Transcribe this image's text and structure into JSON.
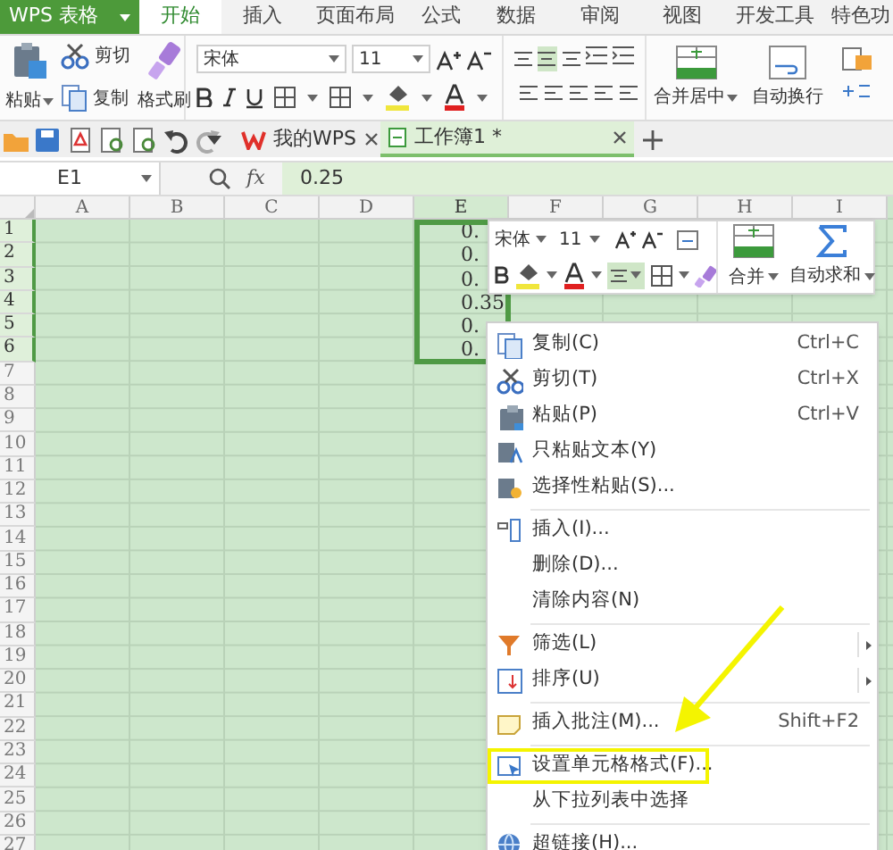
{
  "app_button": {
    "label": "WPS 表格"
  },
  "menu_tabs": [
    {
      "label": "开始",
      "selected": true
    },
    {
      "label": "插入",
      "selected": false
    },
    {
      "label": "页面布局",
      "selected": false
    },
    {
      "label": "公式",
      "selected": false
    },
    {
      "label": "数据",
      "selected": false
    },
    {
      "label": "审阅",
      "selected": false
    },
    {
      "label": "视图",
      "selected": false
    },
    {
      "label": "开发工具",
      "selected": false
    },
    {
      "label": "特色功",
      "selected": false
    }
  ],
  "ribbon": {
    "paste": "粘贴",
    "cut": "剪切",
    "copy": "复制",
    "format_painter": "格式刷",
    "font_name": "宋体",
    "font_size": "11",
    "merge_center": "合并居中",
    "wrap_text": "自动换行",
    "alignment": [
      {
        "selected": false
      },
      {
        "selected": true
      },
      {
        "selected": false
      }
    ]
  },
  "doc_tabs": [
    {
      "label": "我的WPS",
      "selected": false
    },
    {
      "label": "工作簿1 *",
      "selected": true
    }
  ],
  "formula_bar": {
    "cell_ref": "E1",
    "fx": "fx",
    "value": "0.25"
  },
  "sheet": {
    "columns": [
      {
        "label": "A",
        "selected": false
      },
      {
        "label": "B",
        "selected": false
      },
      {
        "label": "C",
        "selected": false
      },
      {
        "label": "D",
        "selected": false
      },
      {
        "label": "E",
        "selected": true
      },
      {
        "label": "F",
        "selected": false
      },
      {
        "label": "G",
        "selected": false
      },
      {
        "label": "H",
        "selected": false
      },
      {
        "label": "I",
        "selected": false
      }
    ],
    "rows": [
      {
        "label": "1",
        "selected": true,
        "e": "0."
      },
      {
        "label": "2",
        "selected": true,
        "e": "0."
      },
      {
        "label": "3",
        "selected": true,
        "e": "0."
      },
      {
        "label": "4",
        "selected": true,
        "e": "0.35"
      },
      {
        "label": "5",
        "selected": true,
        "e": "0."
      },
      {
        "label": "6",
        "selected": true,
        "e": "0."
      },
      {
        "label": "7",
        "selected": false
      },
      {
        "label": "8",
        "selected": false
      },
      {
        "label": "9",
        "selected": false
      },
      {
        "label": "10",
        "selected": false
      },
      {
        "label": "11",
        "selected": false
      },
      {
        "label": "12",
        "selected": false
      },
      {
        "label": "13",
        "selected": false
      },
      {
        "label": "14",
        "selected": false
      },
      {
        "label": "15",
        "selected": false
      },
      {
        "label": "16",
        "selected": false
      },
      {
        "label": "17",
        "selected": false
      },
      {
        "label": "18",
        "selected": false
      },
      {
        "label": "19",
        "selected": false
      },
      {
        "label": "20",
        "selected": false
      },
      {
        "label": "21",
        "selected": false
      },
      {
        "label": "22",
        "selected": false
      },
      {
        "label": "23",
        "selected": false
      },
      {
        "label": "24",
        "selected": false
      },
      {
        "label": "25",
        "selected": false
      },
      {
        "label": "26",
        "selected": false
      },
      {
        "label": "27",
        "selected": false
      }
    ]
  },
  "mini_toolbar": {
    "font_name": "宋体",
    "font_size": "11",
    "merge": "合并",
    "autosum": "自动求和",
    "center_align": {
      "selected": true
    }
  },
  "context_menu": {
    "items": [
      {
        "kind": "item",
        "label": "复制(C)",
        "shortcut": "Ctrl+C"
      },
      {
        "kind": "item",
        "label": "剪切(T)",
        "shortcut": "Ctrl+X"
      },
      {
        "kind": "item",
        "label": "粘贴(P)",
        "shortcut": "Ctrl+V"
      },
      {
        "kind": "item",
        "label": "只粘贴文本(Y)"
      },
      {
        "kind": "item",
        "label": "选择性粘贴(S)..."
      },
      {
        "kind": "separator"
      },
      {
        "kind": "item",
        "label": "插入(I)..."
      },
      {
        "kind": "item",
        "label": "删除(D)..."
      },
      {
        "kind": "item",
        "label": "清除内容(N)"
      },
      {
        "kind": "separator"
      },
      {
        "kind": "item",
        "label": "筛选(L)",
        "submenu": true
      },
      {
        "kind": "item",
        "label": "排序(U)",
        "submenu": true
      },
      {
        "kind": "separator"
      },
      {
        "kind": "item",
        "label": "插入批注(M)...",
        "shortcut": "Shift+F2"
      },
      {
        "kind": "separator"
      },
      {
        "kind": "item",
        "label": "设置单元格格式(F)...",
        "marked": true
      },
      {
        "kind": "item",
        "label": "从下拉列表中选择"
      },
      {
        "kind": "separator"
      },
      {
        "kind": "item",
        "label": "超链接(H)..."
      }
    ]
  }
}
